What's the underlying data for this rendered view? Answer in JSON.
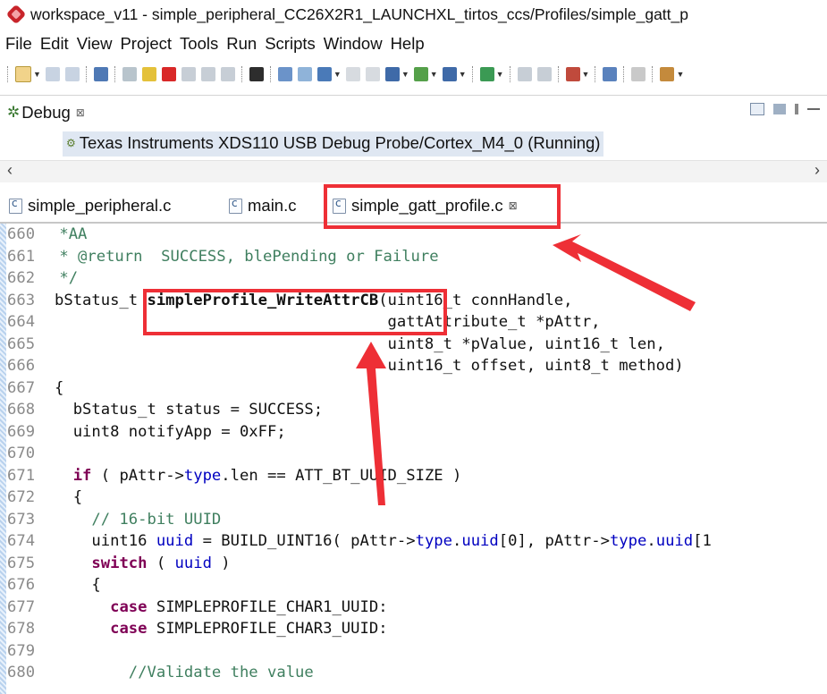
{
  "window": {
    "title": "workspace_v11 - simple_peripheral_CC26X2R1_LAUNCHXL_tirtos_ccs/Profiles/simple_gatt_p"
  },
  "menu": [
    "File",
    "Edit",
    "View",
    "Project",
    "Tools",
    "Run",
    "Scripts",
    "Window",
    "Help"
  ],
  "debug": {
    "title": "Debug",
    "close_glyph": "⊠",
    "probe": "Texas Instruments XDS110 USB Debug Probe/Cortex_M4_0 (Running)",
    "scroll_left": "‹",
    "scroll_right": "›"
  },
  "tabs": [
    {
      "label": "simple_peripheral.c",
      "active": false
    },
    {
      "label": "main.c",
      "active": false
    },
    {
      "label": "simple_gatt_profile.c",
      "active": true,
      "close_glyph": "⊠"
    }
  ],
  "code_lines": [
    {
      "n": "660",
      "t": " *AA"
    },
    {
      "n": "661",
      "t": " * @return  SUCCESS, blePending or Failure"
    },
    {
      "n": "662",
      "t": " */"
    },
    {
      "n": "663",
      "t": "bStatus_t simpleProfile_WriteAttrCB(uint16_t connHandle,"
    },
    {
      "n": "664",
      "t": "                                    gattAttribute_t *pAttr,"
    },
    {
      "n": "665",
      "t": "                                    uint8_t *pValue, uint16_t len,"
    },
    {
      "n": "666",
      "t": "                                    uint16_t offset, uint8_t method)"
    },
    {
      "n": "667",
      "t": "{"
    },
    {
      "n": "668",
      "t": "  bStatus_t status = SUCCESS;"
    },
    {
      "n": "669",
      "t": "  uint8 notifyApp = 0xFF;"
    },
    {
      "n": "670",
      "t": ""
    },
    {
      "n": "671",
      "t": "  if ( pAttr->type.len == ATT_BT_UUID_SIZE )"
    },
    {
      "n": "672",
      "t": "  {"
    },
    {
      "n": "673",
      "t": "    // 16-bit UUID"
    },
    {
      "n": "674",
      "t": "    uint16 uuid = BUILD_UINT16( pAttr->type.uuid[0], pAttr->type.uuid[1"
    },
    {
      "n": "675",
      "t": "    switch ( uuid )"
    },
    {
      "n": "676",
      "t": "    {"
    },
    {
      "n": "677",
      "t": "      case SIMPLEPROFILE_CHAR1_UUID:"
    },
    {
      "n": "678",
      "t": "      case SIMPLEPROFILE_CHAR3_UUID:"
    },
    {
      "n": "679",
      "t": ""
    },
    {
      "n": "680",
      "t": "        //Validate the value"
    }
  ],
  "annotation_color": "#ee2f36"
}
